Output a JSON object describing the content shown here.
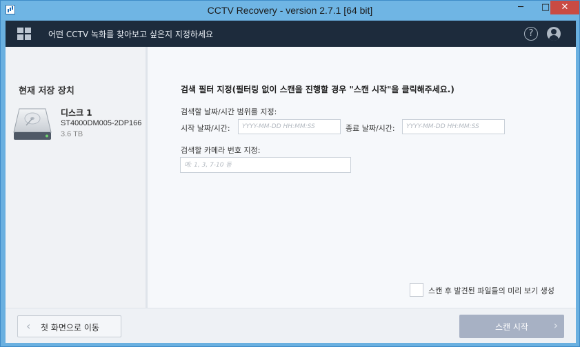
{
  "window": {
    "title": "CCTV Recovery - version 2.7.1 [64 bit]",
    "controls": {
      "minimize": "─",
      "maximize": "□",
      "close": "✕"
    }
  },
  "header": {
    "subtitle": "어떤 CCTV 녹화를 찾아보고 싶은지 지정하세요",
    "help_symbol": "?",
    "icons": [
      "grid-icon",
      "help-icon",
      "user-icon"
    ]
  },
  "storage": {
    "heading": "현재 저장 장치",
    "disk": {
      "name": "디스크 1",
      "model": "ST4000DM005-2DP166",
      "size": "3.6 TB"
    }
  },
  "filter": {
    "title": "검색 필터 지정(필터링 없이 스캔을 진행할 경우 \"스캔 시작\"을 클릭해주세요.)",
    "range_label": "검색할 날짜/시간 범위를 지정:",
    "start_label": "시작 날짜/시간:",
    "start_placeholder": "YYYY-MM-DD HH:MM:SS",
    "start_value": "",
    "end_label": "종료 날짜/시간:",
    "end_placeholder": "YYYY-MM-DD HH:MM:SS",
    "end_value": "",
    "camera_label": "검색할 카메라 번호 지정:",
    "camera_placeholder": "예: 1, 3, 7-10 등",
    "camera_value": ""
  },
  "preview": {
    "label": "스캔 후 발견된 파일들의 미리 보기 생성",
    "checked": false
  },
  "footer": {
    "back_label": "첫 화면으로 이동",
    "back_chevron": "‹",
    "scan_label": "스캔 시작",
    "scan_chevron": "›"
  },
  "colors": {
    "titlebar": "#6fb5e4",
    "header_bg": "#1d2b3c",
    "close_button": "#c94b43",
    "scan_button": "#a7b1c4"
  }
}
